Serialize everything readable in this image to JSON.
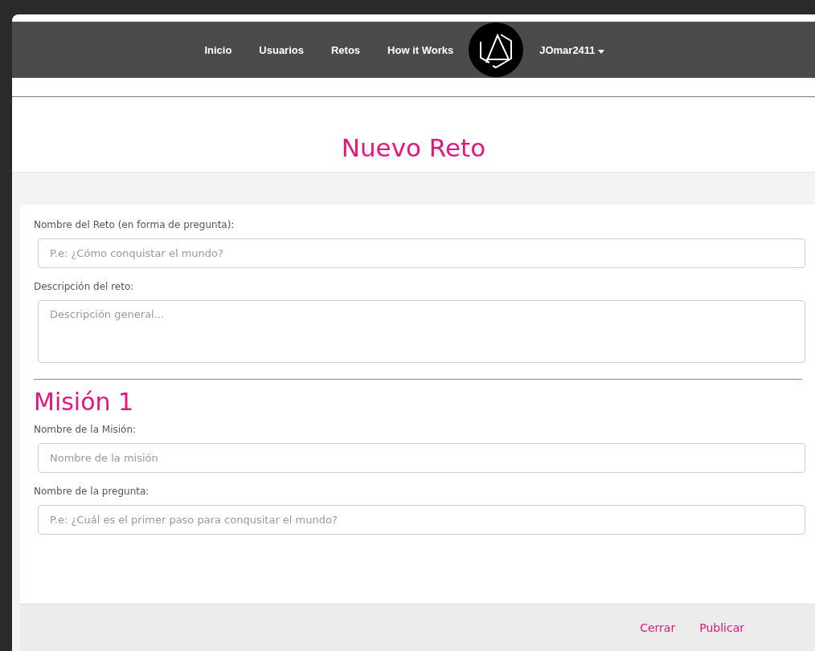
{
  "nav": {
    "links": [
      {
        "label": "Inicio"
      },
      {
        "label": "Usuarios"
      },
      {
        "label": "Retos"
      },
      {
        "label": "How it Works"
      }
    ],
    "user": "JOmar2411"
  },
  "page_title": "Nuevo Reto",
  "form": {
    "fields": [
      {
        "kind": "input",
        "label": "Nombre del Reto (en forma de pregunta):",
        "placeholder": "P.e: ¿Cómo conquistar el mundo?"
      },
      {
        "kind": "textarea",
        "label": "Descripción del reto:",
        "placeholder": "Descripción general..."
      }
    ],
    "mission": {
      "title": "Misión 1",
      "fields": [
        {
          "kind": "input",
          "label": "Nombre de la Misión:",
          "placeholder": "Nombre de la misión"
        },
        {
          "kind": "input",
          "label": "Nombre de la pregunta:",
          "placeholder": "P.e: ¿Cuál es el primer paso para conqusitar el mundo?"
        }
      ]
    }
  },
  "footer_buttons": [
    "Cerrar",
    "Publicar"
  ]
}
